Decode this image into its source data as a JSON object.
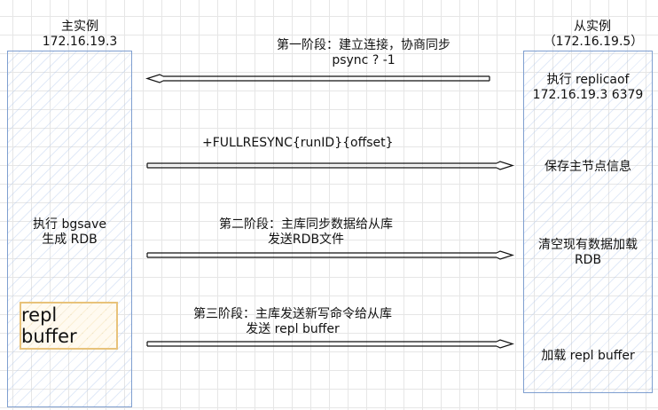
{
  "master": {
    "title": "主实例",
    "ip": "172.16.19.3",
    "action_line1": "执行 bgsave",
    "action_line2": "生成 RDB",
    "buffer_label": "repl buffer"
  },
  "slave": {
    "title": "从实例",
    "ip": "（172.16.19.5）",
    "step1_line1": "执行 replicaof",
    "step1_line2": "172.16.19.3 6379",
    "step2": "保存主节点信息",
    "step3_line1": "清空现有数据加载",
    "step3_line2": "RDB",
    "step4": "加载 repl buffer"
  },
  "messages": {
    "phase1_line1": "第一阶段：建立连接，协商同步",
    "phase1_line2": "psync ? -1",
    "fullresync": "+FULLRESYNC{runID}{offset}",
    "phase2_line1": "第二阶段：主库同步数据给从库",
    "phase2_line2": "发送RDB文件",
    "phase3_line1": "第三阶段：主库发送新写命令给从库",
    "phase3_line2": "发送 repl buffer"
  }
}
